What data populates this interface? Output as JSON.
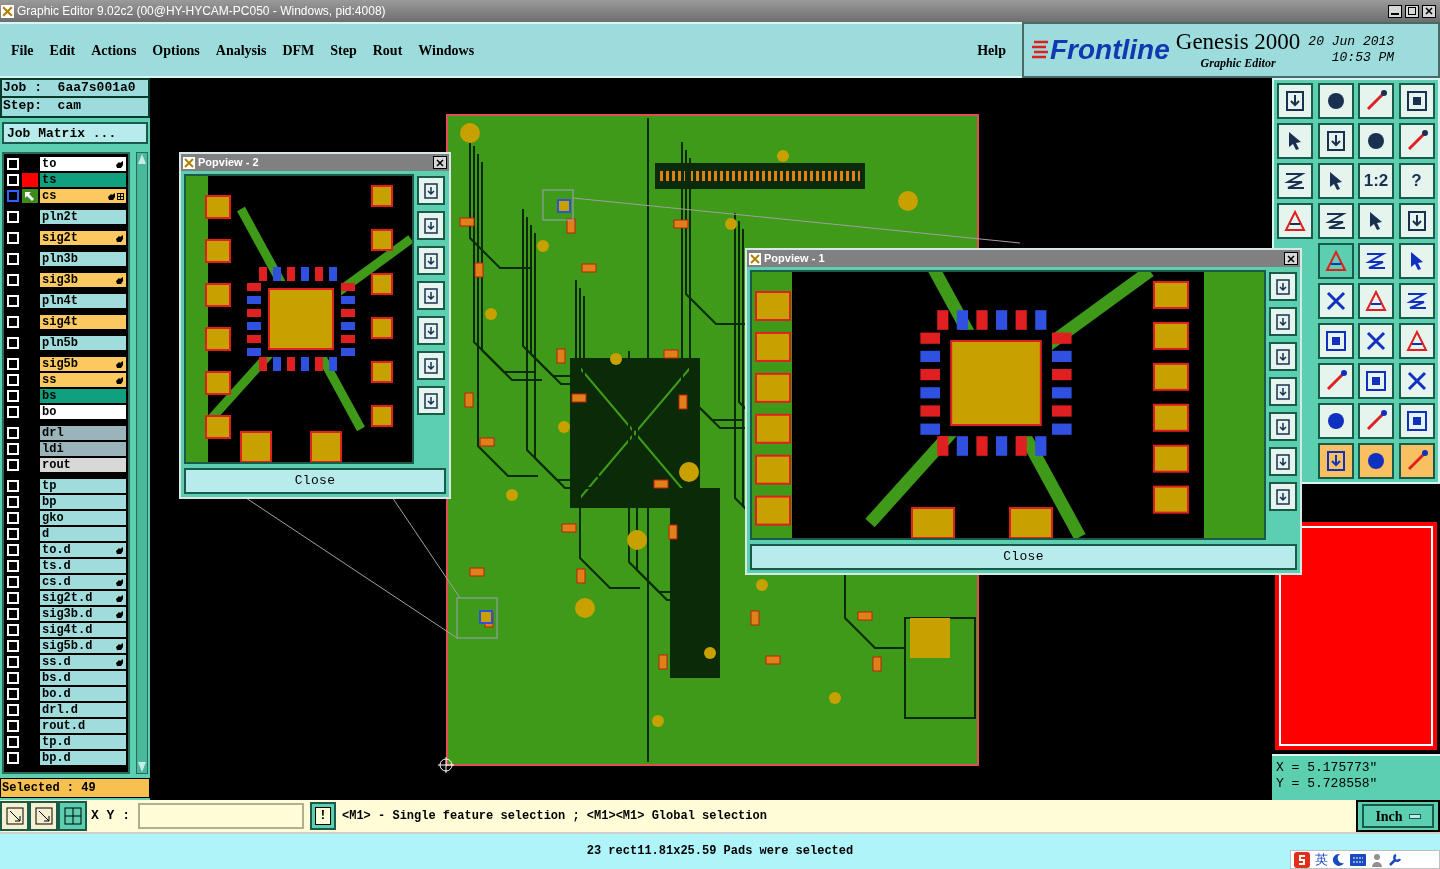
{
  "window": {
    "title": "Graphic Editor 9.02c2 (00@HY-HYCAM-PC050 - Windows, pid:4008)"
  },
  "menu": [
    "File",
    "Edit",
    "Actions",
    "Options",
    "Analysis",
    "DFM",
    "Step",
    "Rout",
    "Windows"
  ],
  "help": "Help",
  "brand": {
    "logo": "Frontline",
    "product": "Genesis 2000",
    "subtitle": "Graphic Editor",
    "date": "20 Jun 2013",
    "time": "10:53 PM"
  },
  "job": {
    "job": "Job :  6aa7s001a0",
    "step": "Step:  cam",
    "matrix_button": "Job Matrix ..."
  },
  "layer_groups": [
    [
      {
        "name": "to",
        "color": "#ffffff",
        "checked": false,
        "affected": true,
        "work": false
      },
      {
        "name": "ts",
        "color": "#10a080",
        "checked": false,
        "affected": false,
        "work": false,
        "swatch": {
          "color": "#ff0000"
        }
      },
      {
        "name": "cs",
        "color": "#fcc860",
        "checked": false,
        "affected": true,
        "work": true
      }
    ],
    [
      {
        "name": "pln2t",
        "color": "#a0dcdc",
        "checked": false,
        "affected": false,
        "work": false
      }
    ],
    [
      {
        "name": "sig2t",
        "color": "#fcc860",
        "checked": false,
        "affected": true,
        "work": false
      }
    ],
    [
      {
        "name": "pln3b",
        "color": "#a0dcdc",
        "checked": false,
        "affected": false,
        "work": false
      }
    ],
    [
      {
        "name": "sig3b",
        "color": "#fcc860",
        "checked": false,
        "affected": true,
        "work": false
      }
    ],
    [
      {
        "name": "pln4t",
        "color": "#a0dcdc",
        "checked": false,
        "affected": false,
        "work": false
      }
    ],
    [
      {
        "name": "sig4t",
        "color": "#fcc860",
        "checked": false,
        "affected": false,
        "work": false
      }
    ],
    [
      {
        "name": "pln5b",
        "color": "#a0dcdc",
        "checked": false,
        "affected": false,
        "work": false
      }
    ],
    [
      {
        "name": "sig5b",
        "color": "#fcc860",
        "checked": false,
        "affected": true,
        "work": false
      },
      {
        "name": "ss",
        "color": "#fcc860",
        "checked": false,
        "affected": true,
        "work": false
      },
      {
        "name": "bs",
        "color": "#10a080",
        "checked": false,
        "affected": false,
        "work": false
      },
      {
        "name": "bo",
        "color": "#ffffff",
        "checked": false,
        "affected": false,
        "work": false
      }
    ],
    [
      {
        "name": "drl",
        "color": "#9ab4bc",
        "checked": false,
        "affected": false,
        "work": false
      },
      {
        "name": "ldi",
        "color": "#9ab4bc",
        "checked": false,
        "affected": false,
        "work": false
      },
      {
        "name": "rout",
        "color": "#d8d8d8",
        "checked": false,
        "affected": false,
        "work": false
      }
    ],
    [
      {
        "name": "tp",
        "color": "#a0dcdc",
        "checked": false,
        "affected": false,
        "work": false
      },
      {
        "name": "bp",
        "color": "#a0dcdc",
        "checked": false,
        "affected": false,
        "work": false
      },
      {
        "name": "gko",
        "color": "#a0dcdc",
        "checked": false,
        "affected": false,
        "work": false
      },
      {
        "name": "d",
        "color": "#a0dcdc",
        "checked": false,
        "affected": false,
        "work": false
      },
      {
        "name": "to.d",
        "color": "#a0dcdc",
        "checked": false,
        "affected": true,
        "work": false
      },
      {
        "name": "ts.d",
        "color": "#a0dcdc",
        "checked": false,
        "affected": false,
        "work": false
      },
      {
        "name": "cs.d",
        "color": "#a0dcdc",
        "checked": false,
        "affected": true,
        "work": false
      },
      {
        "name": "sig2t.d",
        "color": "#a0dcdc",
        "checked": false,
        "affected": true,
        "work": false
      },
      {
        "name": "sig3b.d",
        "color": "#a0dcdc",
        "checked": false,
        "affected": true,
        "work": false
      },
      {
        "name": "sig4t.d",
        "color": "#a0dcdc",
        "checked": false,
        "affected": false,
        "work": false
      },
      {
        "name": "sig5b.d",
        "color": "#a0dcdc",
        "checked": false,
        "affected": true,
        "work": false
      },
      {
        "name": "ss.d",
        "color": "#a0dcdc",
        "checked": false,
        "affected": true,
        "work": false
      },
      {
        "name": "bs.d",
        "color": "#a0dcdc",
        "checked": false,
        "affected": false,
        "work": false
      },
      {
        "name": "bo.d",
        "color": "#a0dcdc",
        "checked": false,
        "affected": false,
        "work": false
      },
      {
        "name": "drl.d",
        "color": "#a0dcdc",
        "checked": false,
        "affected": false,
        "work": false
      },
      {
        "name": "rout.d",
        "color": "#a0dcdc",
        "checked": false,
        "affected": false,
        "work": false
      },
      {
        "name": "tp.d",
        "color": "#a0dcdc",
        "checked": false,
        "affected": false,
        "work": false
      },
      {
        "name": "bp.d",
        "color": "#a0dcdc",
        "checked": false,
        "affected": false,
        "work": false
      }
    ]
  ],
  "selected": "Selected : 49",
  "toolbar_labels": [
    "1:2",
    "?"
  ],
  "popviews": [
    {
      "title": "Popview - 2",
      "close": "Close"
    },
    {
      "title": "Popview - 1",
      "close": "Close"
    }
  ],
  "coordinates": {
    "x": "X = 5.175773\"",
    "y": "Y = 5.728558\""
  },
  "bottom": {
    "xy_label": "X Y :",
    "alert": "!",
    "prompt": "<M1> - Single feature selection ; <M1><M1> Global selection",
    "units": "Inch"
  },
  "status": "23 rect11.81x25.59 Pads were selected",
  "tray": {
    "input_mode": "英"
  }
}
